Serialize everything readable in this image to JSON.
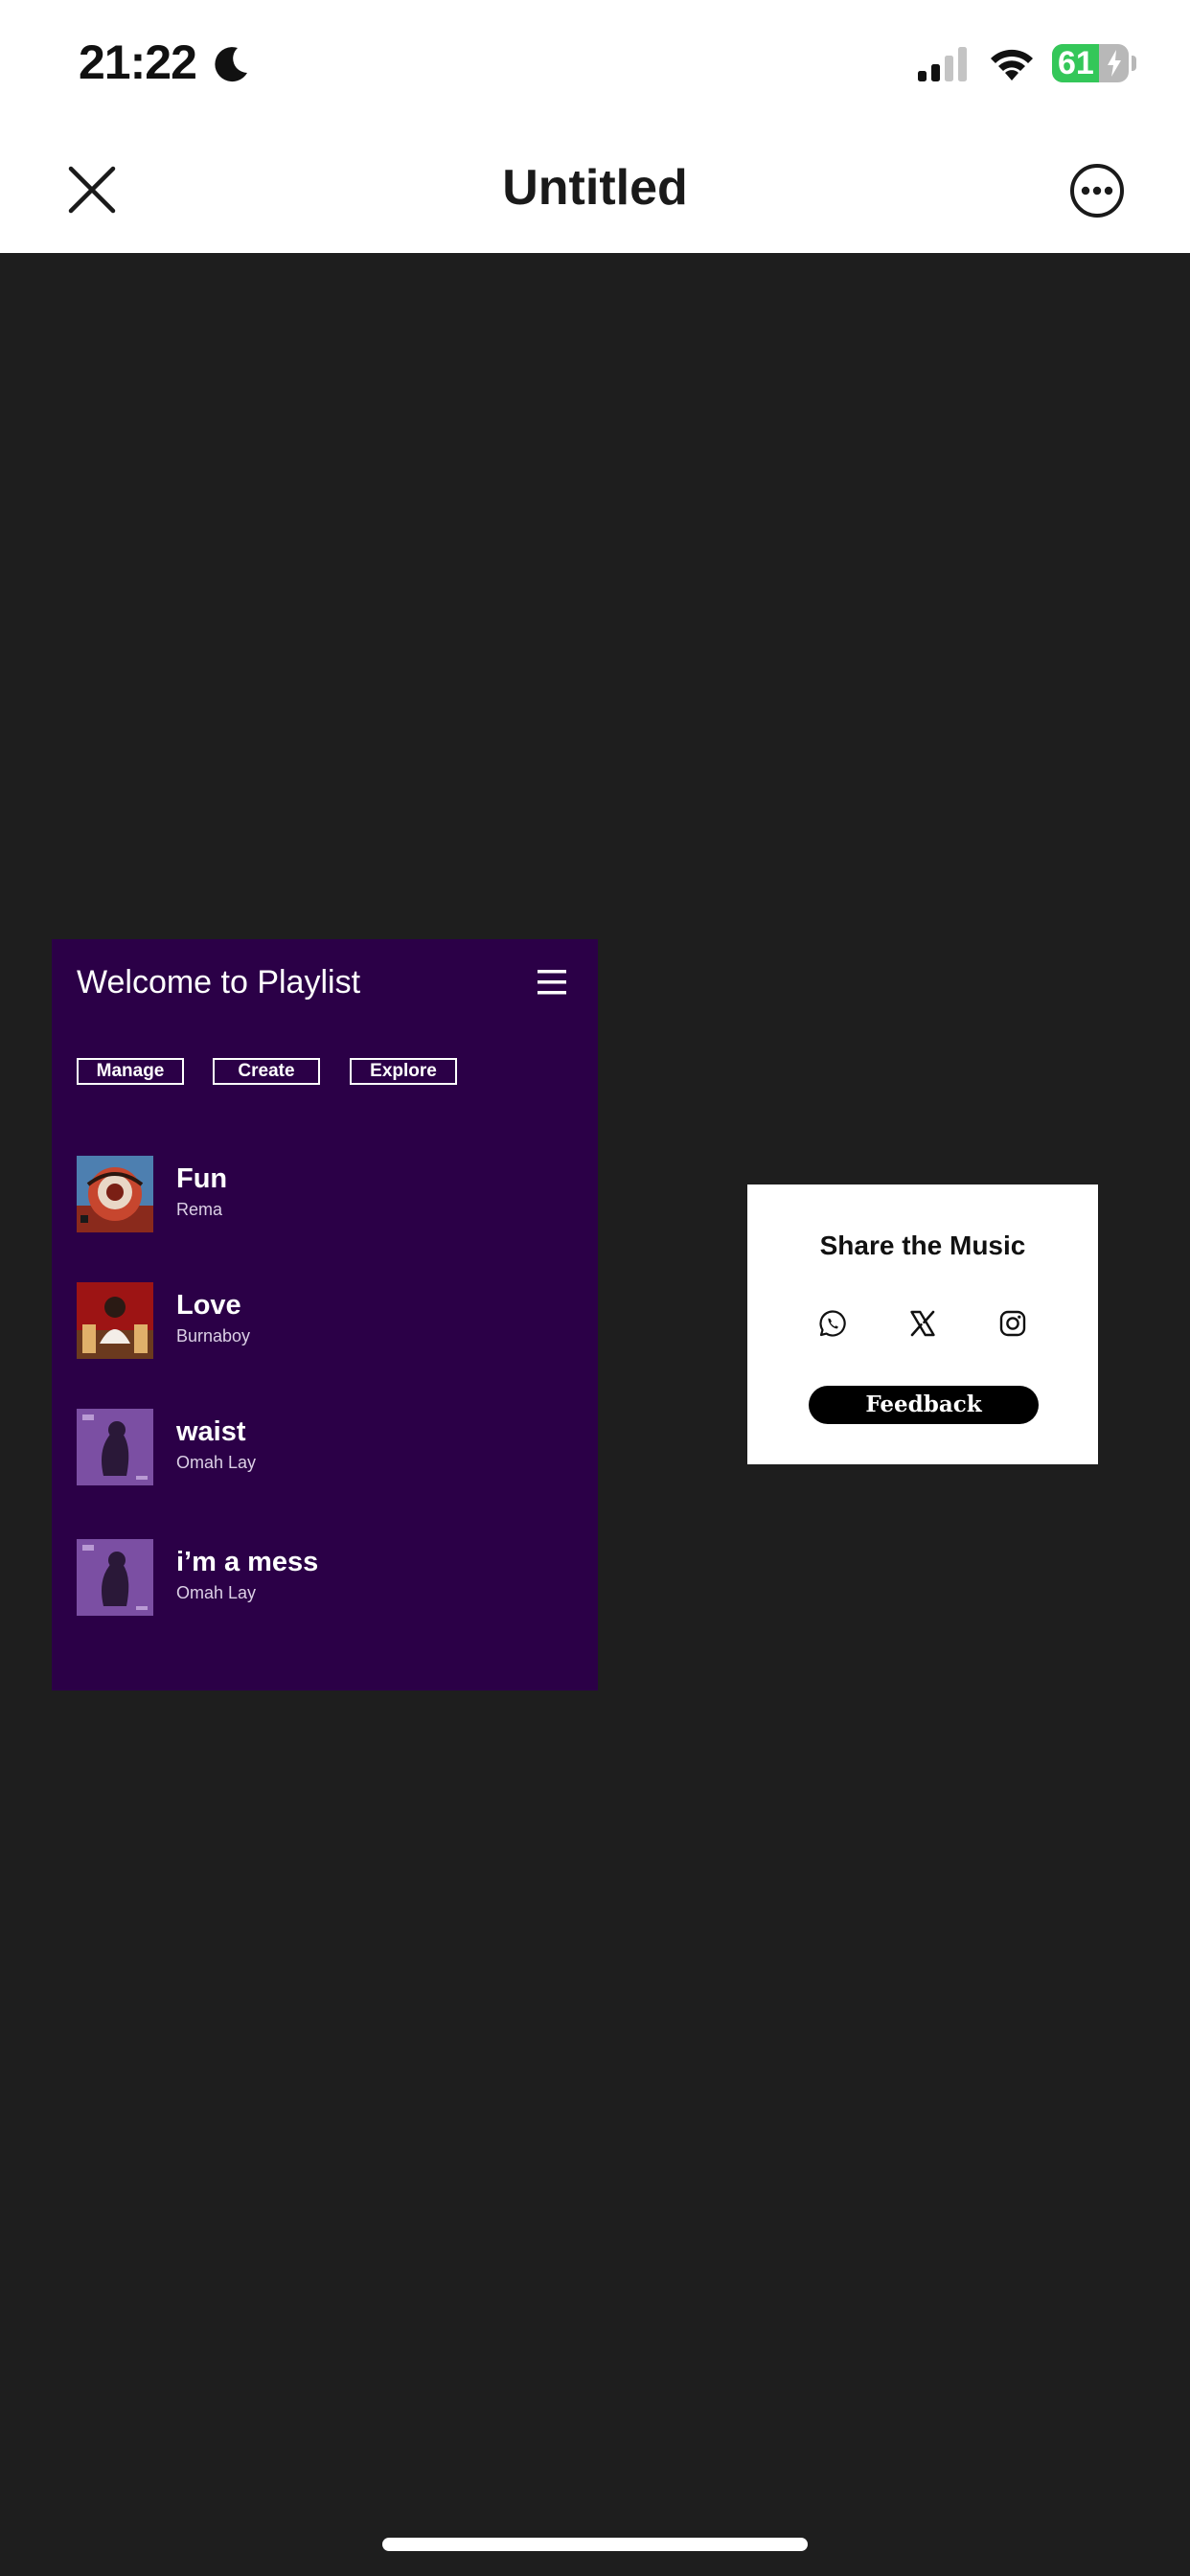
{
  "status_bar": {
    "time": "21:22",
    "battery_level": "61",
    "battery_fraction": 0.61
  },
  "nav": {
    "title": "Untitled",
    "close_icon": "close-icon",
    "more_icon": "more-icon"
  },
  "playlist": {
    "title": "Welcome to Playlist",
    "menu_icon": "hamburger-menu-icon",
    "background": "#2b0047",
    "buttons": [
      "Manage",
      "Create",
      "Explore"
    ],
    "tracks": [
      {
        "title": "Fun",
        "artist": "Rema"
      },
      {
        "title": "Love",
        "artist": "Burnaboy"
      },
      {
        "title": "waist",
        "artist": "Omah Lay"
      },
      {
        "title": "i’m a mess",
        "artist": "Omah Lay"
      }
    ]
  },
  "share": {
    "title": "Share the Music",
    "icons": [
      "whatsapp-icon",
      "x-icon",
      "instagram-icon"
    ],
    "feedback_label": "Feedback"
  },
  "colors": {
    "canvas": "#1e1e1e",
    "accent_purple": "#2b0047",
    "battery_green": "#34c759"
  }
}
